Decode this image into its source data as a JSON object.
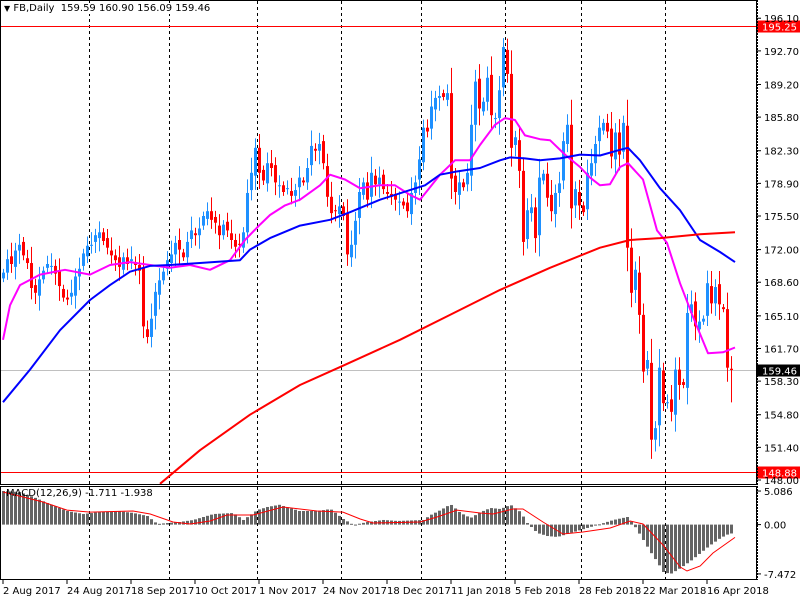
{
  "header": {
    "symbol_arrow": "▼",
    "title": "FB,Daily",
    "ohlc": "159.59 160.90 156.09 159.46"
  },
  "macd_label": "MACD(12,26,9) -1.711 -1.938",
  "colors": {
    "bull": "#1E90FF",
    "bear": "#FF0000",
    "ma_fast": "#FF00FF",
    "ma_mid": "#0000FF",
    "ma_slow": "#FF0000",
    "macd_hist": "#646464",
    "macd_signal": "#FF0000"
  },
  "chart_data": [
    {
      "type": "candlestick",
      "title": "FB,Daily",
      "ylim": [
        148.0,
        196.1
      ],
      "y_ticks": [
        "196.10",
        "192.70",
        "189.20",
        "185.80",
        "182.30",
        "178.90",
        "175.50",
        "172.00",
        "168.60",
        "165.10",
        "161.70",
        "158.30",
        "154.80",
        "151.40",
        "148.00"
      ],
      "x_labels": [
        {
          "bar": 0,
          "label": "2 Aug 2017"
        },
        {
          "bar": 16,
          "label": "24 Aug 2017"
        },
        {
          "bar": 32,
          "label": "18 Sep 2017"
        },
        {
          "bar": 48,
          "label": "10 Oct 2017"
        },
        {
          "bar": 64,
          "label": "1 Nov 2017"
        },
        {
          "bar": 80,
          "label": "24 Nov 2017"
        },
        {
          "bar": 96,
          "label": "18 Dec 2017"
        },
        {
          "bar": 112,
          "label": "11 Jan 2018"
        },
        {
          "bar": 128,
          "label": "5 Feb 2018"
        },
        {
          "bar": 144,
          "label": "28 Feb 2018"
        },
        {
          "bar": 160,
          "label": "22 Mar 2018"
        },
        {
          "bar": 176,
          "label": "16 Apr 2018"
        }
      ],
      "period_separators": [
        22,
        42,
        64,
        85,
        105,
        126,
        145,
        166
      ],
      "closes": [
        169.6,
        171.0,
        170.5,
        171.9,
        172.5,
        171.4,
        170.6,
        168.0,
        167.5,
        168.9,
        169.8,
        170.5,
        170.3,
        169.5,
        168.2,
        167.0,
        166.8,
        167.5,
        169.2,
        170.0,
        171.6,
        172.4,
        172.5,
        173.5,
        173.8,
        172.9,
        172.2,
        171.4,
        170.9,
        170.2,
        171.2,
        170.5,
        171.0,
        170.4,
        169.8,
        164.0,
        162.9,
        164.8,
        167.6,
        168.8,
        169.7,
        170.9,
        171.5,
        172.7,
        172.0,
        171.2,
        172.8,
        174.0,
        173.5,
        174.2,
        175.5,
        176.0,
        175.1,
        174.8,
        173.5,
        174.6,
        174.0,
        173.0,
        172.3,
        172.5,
        173.8,
        177.9,
        180.0,
        182.6,
        180.0,
        179.2,
        181.0,
        180.5,
        179.0,
        178.7,
        178.0,
        178.4,
        177.6,
        178.2,
        179.5,
        179.0,
        180.5,
        182.8,
        182.3,
        183.0,
        181.0,
        177.5,
        175.8,
        176.0,
        176.5,
        175.5,
        171.5,
        172.5,
        175.0,
        178.0,
        179.0,
        177.2,
        180.0,
        178.8,
        179.5,
        178.3,
        177.8,
        177.5,
        177.2,
        177.0,
        176.6,
        176.0,
        177.9,
        179.0,
        181.4,
        184.7,
        184.3,
        186.9,
        187.8,
        188.0,
        187.9,
        188.3,
        179.4,
        178.0,
        179.0,
        178.5,
        180.0,
        185.0,
        189.5,
        186.7,
        187.4,
        189.9,
        186.0,
        185.7,
        188.6,
        193.1,
        190.3,
        182.6,
        183.7,
        180.2,
        172.8,
        176.1,
        176.4,
        173.2,
        179.5,
        179.9,
        177.4,
        176.0,
        177.9,
        178.9,
        183.3,
        185.0,
        176.3,
        178.3,
        176.6,
        175.9,
        180.0,
        181.0,
        183.0,
        184.7,
        185.2,
        184.3,
        181.7,
        184.2,
        181.9,
        185.2,
        172.2,
        167.5,
        169.9,
        165.2,
        159.3,
        160.5,
        152.2,
        153.4,
        159.7,
        156.0,
        156.1,
        155.1,
        159.5,
        157.9,
        157.9,
        165.4,
        166.3,
        164.0,
        164.5,
        164.8,
        168.5,
        166.4,
        168.1,
        166.3,
        165.8,
        159.7,
        159.46
      ],
      "last_candle": {
        "open": 159.59,
        "high": 160.9,
        "low": 156.09,
        "close": 159.46
      },
      "moving_averages": [
        {
          "name": "fast",
          "points": [
            [
              0,
              162.6
            ],
            [
              1.75,
              166.2
            ],
            [
              4.25,
              168.3
            ],
            [
              9.25,
              169.4
            ],
            [
              15.5,
              169.9
            ],
            [
              21.75,
              169.4
            ],
            [
              26.75,
              170.4
            ],
            [
              31.75,
              170.7
            ],
            [
              36.75,
              170.4
            ],
            [
              41.75,
              170.1
            ],
            [
              46.75,
              170.4
            ],
            [
              51.75,
              169.9
            ],
            [
              56.75,
              170.9
            ],
            [
              60.5,
              173.0
            ],
            [
              64.25,
              174.6
            ],
            [
              66.75,
              175.6
            ],
            [
              70.5,
              176.6
            ],
            [
              74.25,
              177.2
            ],
            [
              79.25,
              178.7
            ],
            [
              81.75,
              179.8
            ],
            [
              85.5,
              179.3
            ],
            [
              89.25,
              178.4
            ],
            [
              94.25,
              178.7
            ],
            [
              98,
              178.7
            ],
            [
              101.75,
              177.7
            ],
            [
              104.25,
              177.2
            ],
            [
              109.25,
              179.8
            ],
            [
              113,
              181.3
            ],
            [
              116.75,
              181.3
            ],
            [
              119.25,
              182.9
            ],
            [
              123,
              185.0
            ],
            [
              125.5,
              185.7
            ],
            [
              128,
              185.5
            ],
            [
              130.5,
              183.9
            ],
            [
              134.25,
              183.5
            ],
            [
              136.75,
              183.4
            ],
            [
              140.5,
              181.9
            ],
            [
              144.25,
              180.6
            ],
            [
              146.75,
              179.5
            ],
            [
              149.25,
              178.7
            ],
            [
              151.75,
              178.8
            ],
            [
              154.25,
              180.6
            ],
            [
              156.25,
              181.0
            ],
            [
              160,
              179.3
            ],
            [
              163.5,
              174.0
            ],
            [
              166,
              172.7
            ],
            [
              169.25,
              168.5
            ],
            [
              172.5,
              165.0
            ],
            [
              176.25,
              161.2
            ],
            [
              180,
              161.3
            ],
            [
              183,
              161.8
            ]
          ]
        },
        {
          "name": "mid",
          "points": [
            [
              0,
              156.1
            ],
            [
              6.75,
              159.5
            ],
            [
              14.25,
              163.6
            ],
            [
              21.75,
              166.75
            ],
            [
              26.75,
              168.3
            ],
            [
              31.75,
              169.7
            ],
            [
              36.75,
              170.3
            ],
            [
              41.75,
              170.4
            ],
            [
              49.25,
              170.6
            ],
            [
              59.25,
              170.9
            ],
            [
              61.75,
              172.0
            ],
            [
              66.75,
              173.2
            ],
            [
              74.25,
              174.5
            ],
            [
              81.75,
              175.1
            ],
            [
              86.75,
              175.9
            ],
            [
              94.25,
              177.2
            ],
            [
              101.75,
              178.2
            ],
            [
              105.5,
              178.7
            ],
            [
              109.25,
              179.8
            ],
            [
              113,
              180.1
            ],
            [
              119.25,
              180.5
            ],
            [
              124.25,
              181.3
            ],
            [
              126.75,
              181.6
            ],
            [
              130.5,
              181.5
            ],
            [
              134.25,
              181.3
            ],
            [
              139.25,
              181.5
            ],
            [
              144.25,
              181.9
            ],
            [
              149.25,
              181.8
            ],
            [
              154.25,
              182.4
            ],
            [
              156.25,
              182.6
            ],
            [
              159.25,
              181.3
            ],
            [
              164.25,
              178.4
            ],
            [
              169.25,
              176.1
            ],
            [
              174.25,
              173.0
            ],
            [
              179.25,
              171.75
            ],
            [
              183,
              170.7
            ]
          ]
        },
        {
          "name": "slow",
          "points": [
            [
              39.25,
              147.6
            ],
            [
              49.25,
              151.1
            ],
            [
              61.75,
              154.8
            ],
            [
              74.25,
              157.9
            ],
            [
              85.5,
              160.0
            ],
            [
              99.25,
              162.6
            ],
            [
              111.75,
              165.2
            ],
            [
              124.25,
              167.8
            ],
            [
              136.75,
              170.1
            ],
            [
              149.25,
              172.2
            ],
            [
              156.75,
              173.0
            ],
            [
              164.25,
              173.2
            ],
            [
              174.25,
              173.6
            ],
            [
              183,
              173.8
            ]
          ]
        }
      ],
      "price_lines": [
        {
          "name": "high-level",
          "value": 195.25,
          "label": "195.25",
          "color": "#FF0000"
        },
        {
          "name": "low-level",
          "value": 148.88,
          "label": "148.88",
          "color": "#FF0000"
        },
        {
          "name": "bid",
          "value": 159.46,
          "label": "159.46",
          "color": "#000000"
        }
      ]
    },
    {
      "type": "bar",
      "title": "MACD(12,26,9)",
      "ylim": [
        -7.472,
        5.086
      ],
      "y_ticks": [
        "5.086",
        "0.00",
        "-7.472"
      ],
      "macd": -1.711,
      "signal": -1.938,
      "histogram_points": [
        [
          0,
          5.09
        ],
        [
          4,
          4.94
        ],
        [
          7.5,
          4.18
        ],
        [
          12,
          3.0
        ],
        [
          16,
          2.06
        ],
        [
          20,
          1.6
        ],
        [
          24,
          1.9
        ],
        [
          28.5,
          2.06
        ],
        [
          32.5,
          1.76
        ],
        [
          36,
          1.3
        ],
        [
          38.5,
          0.09
        ],
        [
          41,
          0.24
        ],
        [
          44,
          0.39
        ],
        [
          47.5,
          0.7
        ],
        [
          52.5,
          1.6
        ],
        [
          57.5,
          1.76
        ],
        [
          60,
          0.7
        ],
        [
          63.5,
          2.2
        ],
        [
          66,
          2.67
        ],
        [
          69,
          3.0
        ],
        [
          74,
          2.06
        ],
        [
          78.5,
          2.06
        ],
        [
          81.8,
          2.36
        ],
        [
          85,
          0.85
        ],
        [
          87.5,
          -0.06
        ],
        [
          91,
          0.39
        ],
        [
          95,
          0.7
        ],
        [
          98.5,
          0.55
        ],
        [
          105,
          0.7
        ],
        [
          106.8,
          1.45
        ],
        [
          109.3,
          2.2
        ],
        [
          111.8,
          3.08
        ],
        [
          114.3,
          1.76
        ],
        [
          116.8,
          1.0
        ],
        [
          119.3,
          1.9
        ],
        [
          121.8,
          2.52
        ],
        [
          124.3,
          2.36
        ],
        [
          126.8,
          3.0
        ],
        [
          129.3,
          1.9
        ],
        [
          131,
          0.24
        ],
        [
          133.5,
          -1.27
        ],
        [
          136,
          -1.73
        ],
        [
          138.5,
          -1.88
        ],
        [
          141,
          -1.42
        ],
        [
          144.3,
          -0.82
        ],
        [
          146.8,
          -0.36
        ],
        [
          149.3,
          0.09
        ],
        [
          152.5,
          0.7
        ],
        [
          156,
          1.15
        ],
        [
          157.5,
          0.09
        ],
        [
          160,
          -2.33
        ],
        [
          161.8,
          -4.15
        ],
        [
          163.5,
          -5.67
        ],
        [
          165,
          -7.18
        ],
        [
          166.8,
          -7.48
        ],
        [
          169.3,
          -6.58
        ],
        [
          171.8,
          -5.52
        ],
        [
          174.3,
          -4.3
        ],
        [
          176.8,
          -3.09
        ],
        [
          179.3,
          -2.03
        ],
        [
          181.8,
          -1.27
        ],
        [
          183,
          -1.71
        ]
      ],
      "signal_points": [
        [
          0,
          4.94
        ],
        [
          10,
          3.42
        ],
        [
          16,
          2.2
        ],
        [
          21.8,
          1.9
        ],
        [
          32.5,
          2.06
        ],
        [
          36.8,
          1.6
        ],
        [
          42.5,
          0.39
        ],
        [
          46.8,
          0.09
        ],
        [
          51.8,
          0.55
        ],
        [
          56,
          1.45
        ],
        [
          62.5,
          1.45
        ],
        [
          70,
          2.67
        ],
        [
          78.5,
          2.06
        ],
        [
          85,
          1.9
        ],
        [
          89.3,
          0.85
        ],
        [
          92.5,
          0.24
        ],
        [
          104.3,
          0.39
        ],
        [
          108.5,
          1.15
        ],
        [
          113.5,
          2.2
        ],
        [
          119.3,
          1.76
        ],
        [
          122.5,
          1.6
        ],
        [
          127.5,
          2.36
        ],
        [
          130,
          2.36
        ],
        [
          135,
          0.39
        ],
        [
          140,
          -1.42
        ],
        [
          145,
          -1.12
        ],
        [
          151.8,
          -0.52
        ],
        [
          156.8,
          0.55
        ],
        [
          160,
          0.09
        ],
        [
          165,
          -3.09
        ],
        [
          169.3,
          -6.42
        ],
        [
          171,
          -7.03
        ],
        [
          174.3,
          -6.27
        ],
        [
          177.5,
          -4.3
        ],
        [
          183,
          -1.94
        ]
      ]
    }
  ]
}
